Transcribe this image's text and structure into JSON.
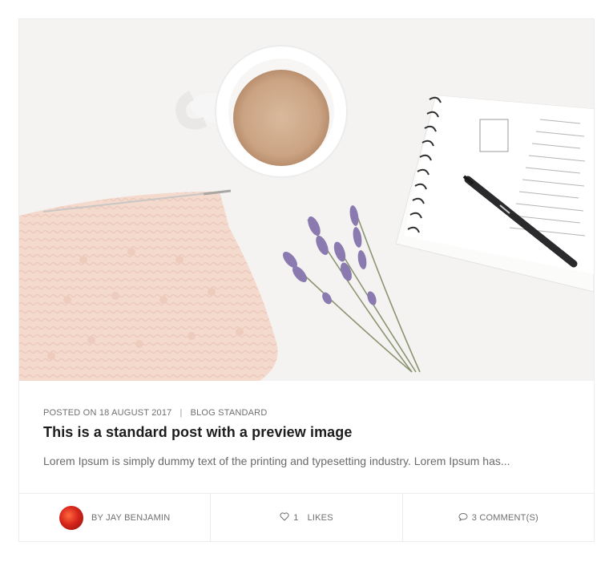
{
  "post": {
    "image_alt": "Coffee cup, knitting, lavender and notebook flat lay",
    "meta": {
      "posted_label": "POSTED ON 18 AUGUST 2017",
      "separator": "|",
      "category": "BLOG STANDARD"
    },
    "title": "This is a standard post with a preview image",
    "excerpt": "Lorem Ipsum is simply dummy text of the printing and typesetting industry. Lorem Ipsum has..."
  },
  "footer": {
    "author": "BY JAY BENJAMIN",
    "likes_count": "1",
    "likes_label": "LIKES",
    "comments": "3 COMMENT(S)"
  },
  "colors": {
    "background": "#ffffff",
    "border": "#ececec",
    "title": "#1d1d1d",
    "meta": "#6f6f6f",
    "avatar": "#d7261c"
  },
  "icons": {
    "likes": "heart-outline-icon",
    "comments": "speech-bubble-icon"
  }
}
